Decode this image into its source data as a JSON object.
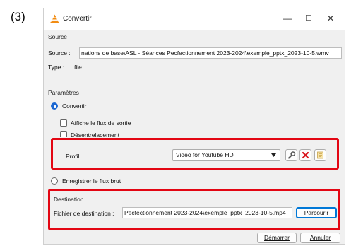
{
  "step_label": "(3)",
  "window": {
    "title": "Convertir",
    "minimize": "—",
    "maximize": "☐",
    "close": "✕"
  },
  "source": {
    "group_title": "Source",
    "source_label": "Source :",
    "source_value": "nations de base\\ASL - Séances Pecfectionnement 2023-2024\\exemple_pptx_2023-10-5.wmv",
    "type_label": "Type :",
    "type_value": "file"
  },
  "parametres": {
    "group_title": "Paramètres",
    "convert_label": "Convertir",
    "show_output_label": "Affiche le flux de sortie",
    "deinterlace_label": "Désentrelacement",
    "profile_label": "Profil",
    "profile_value": "Video for Youtube HD",
    "raw_dump_label": "Enregistrer le flux brut"
  },
  "destination": {
    "group_title": "Destination",
    "file_label": "Fichier de destination :",
    "file_value": "Pecfectionnement 2023-2024\\exemple_pptx_2023-10-5.mp4",
    "browse_label": "Parcourir"
  },
  "footer": {
    "start_label": "Démarrer",
    "cancel_label": "Annuler"
  },
  "colors": {
    "highlight": "#e30613",
    "radio_selected": "#1a67d2",
    "focus_border": "#0078d7"
  },
  "icons": [
    "vlc-cone-icon",
    "wrench-icon",
    "delete-icon",
    "new-profile-icon",
    "dropdown-arrow-icon"
  ]
}
